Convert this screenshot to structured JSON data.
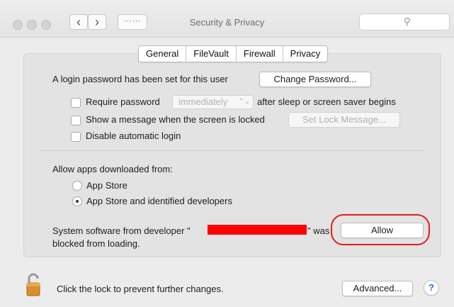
{
  "window": {
    "title": "Security & Privacy"
  },
  "tabs": [
    {
      "label": "General"
    },
    {
      "label": "FileVault"
    },
    {
      "label": "Firewall"
    },
    {
      "label": "Privacy"
    }
  ],
  "general": {
    "login_text": "A login password has been set for this user",
    "change_password_label": "Change Password...",
    "require_password_label": "Require password",
    "require_password_select": "immediately",
    "require_password_suffix": "after sleep or screen saver begins",
    "show_message_label": "Show a message when the screen is locked",
    "set_lock_message_label": "Set Lock Message...",
    "disable_autologin_label": "Disable automatic login",
    "allow_apps_heading": "Allow apps downloaded from:",
    "option_app_store": "App Store",
    "option_identified": "App Store and identified developers",
    "selected_option": "App Store and identified developers",
    "blocked_prefix": "System software from developer \"",
    "blocked_suffix": "\" was",
    "blocked_line2": "blocked from loading.",
    "allow_label": "Allow"
  },
  "footer": {
    "lock_text": "Click the lock to prevent further changes.",
    "advanced_label": "Advanced...",
    "help_label": "?"
  },
  "colors": {
    "annotation": "#e31b1b",
    "redaction": "#ff0000"
  }
}
